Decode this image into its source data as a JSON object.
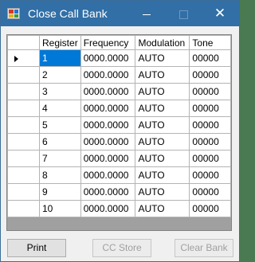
{
  "window": {
    "title": "Close Call Bank",
    "close_glyph": "✕"
  },
  "grid": {
    "columns": [
      "Register",
      "Frequency",
      "Modulation",
      "Tone"
    ],
    "selected_row": 0,
    "rows": [
      {
        "register": "1",
        "frequency": "0000.0000",
        "modulation": "AUTO",
        "tone": "00000"
      },
      {
        "register": "2",
        "frequency": "0000.0000",
        "modulation": "AUTO",
        "tone": "00000"
      },
      {
        "register": "3",
        "frequency": "0000.0000",
        "modulation": "AUTO",
        "tone": "00000"
      },
      {
        "register": "4",
        "frequency": "0000.0000",
        "modulation": "AUTO",
        "tone": "00000"
      },
      {
        "register": "5",
        "frequency": "0000.0000",
        "modulation": "AUTO",
        "tone": "00000"
      },
      {
        "register": "6",
        "frequency": "0000.0000",
        "modulation": "AUTO",
        "tone": "00000"
      },
      {
        "register": "7",
        "frequency": "0000.0000",
        "modulation": "AUTO",
        "tone": "00000"
      },
      {
        "register": "8",
        "frequency": "0000.0000",
        "modulation": "AUTO",
        "tone": "00000"
      },
      {
        "register": "9",
        "frequency": "0000.0000",
        "modulation": "AUTO",
        "tone": "00000"
      },
      {
        "register": "10",
        "frequency": "0000.0000",
        "modulation": "AUTO",
        "tone": "00000"
      }
    ]
  },
  "buttons": {
    "print": "Print",
    "cc_store": "CC Store",
    "clear_bank": "Clear Bank"
  },
  "colors": {
    "titlebar": "#316fa6",
    "selection": "#0078d7"
  },
  "icons": {
    "app": "app-icon",
    "row_pointer": "row-pointer-icon"
  }
}
